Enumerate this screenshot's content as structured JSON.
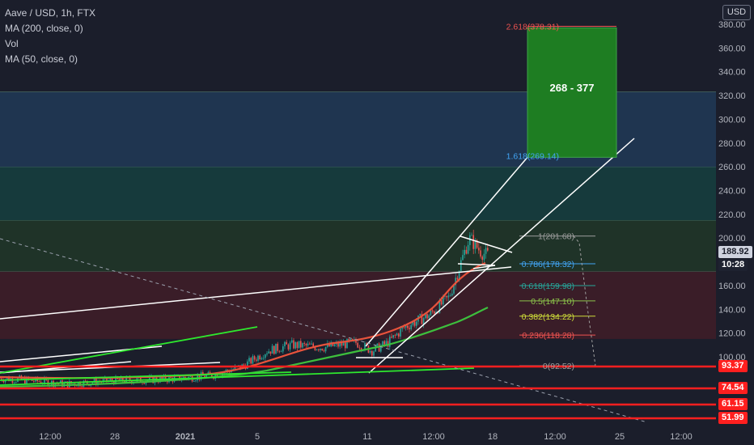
{
  "legend": {
    "symbol": "Aave / USD, 1h, FTX",
    "ma200": "MA (200, close, 0)",
    "vol": "Vol",
    "ma50": "MA (50, close, 0)"
  },
  "currency_button": "USD",
  "price_tags": {
    "current_price": "188.92",
    "countdown": "10:28",
    "support_1": "93.37",
    "support_2": "74.54",
    "support_3": "61.15",
    "support_4": "51.99"
  },
  "target_box_label": "268 - 377",
  "colors": {
    "background": "#1b1e2b",
    "support_line": "#ff1f1f",
    "target_box": "#1e7d22",
    "ma50": "#e8533c",
    "ma200": "#3dbf3d",
    "trendline": "#ffffff",
    "candle_up": "#26a69a",
    "candle_down": "#ef5350"
  },
  "chart_data": {
    "type": "candlestick",
    "title": "Aave / USD, 1h, FTX",
    "y_axis": {
      "ticks": [
        100,
        120,
        140,
        160,
        180,
        200,
        220,
        240,
        260,
        280,
        300,
        320,
        340,
        360,
        380
      ],
      "range": [
        48,
        384
      ],
      "side": "right"
    },
    "x_axis": {
      "ticks": [
        "12:00",
        "28",
        "2021",
        "5",
        "11",
        "12:00",
        "18",
        "12:00",
        "25",
        "12:00"
      ]
    },
    "fib_levels": [
      {
        "label": "0(92.52)",
        "value": 92.52,
        "color": "#9e9e9e"
      },
      {
        "label": "0.236(118.28)",
        "value": 118.28,
        "color": "#ef5350"
      },
      {
        "label": "0.382(134.22)",
        "value": 134.22,
        "color": "#cddc39"
      },
      {
        "label": "0.5(147.10)",
        "value": 147.1,
        "color": "#8bc34a"
      },
      {
        "label": "0.618(159.98)",
        "value": 159.98,
        "color": "#26a69a"
      },
      {
        "label": "0.786(178.32)",
        "value": 178.32,
        "color": "#42a5f5"
      },
      {
        "label": "1(201.68)",
        "value": 201.68,
        "color": "#9e9e9e"
      },
      {
        "label": "1.618(269.14)",
        "value": 269.14,
        "color": "#42a5f5"
      },
      {
        "label": "2.618(378.31)",
        "value": 378.31,
        "color": "#ef5350"
      }
    ],
    "fib_zones": [
      {
        "from": 115,
        "to": 172,
        "color": "#3a1d28"
      },
      {
        "from": 172,
        "to": 215,
        "color": "#1f3328"
      },
      {
        "from": 215,
        "to": 260,
        "color": "#163a3c"
      },
      {
        "from": 260,
        "to": 323,
        "color": "#1f3550"
      }
    ],
    "support_levels": [
      93.37,
      74.54,
      61.15,
      51.99
    ],
    "current_price": 188.92,
    "target_range": [
      268,
      377
    ]
  }
}
